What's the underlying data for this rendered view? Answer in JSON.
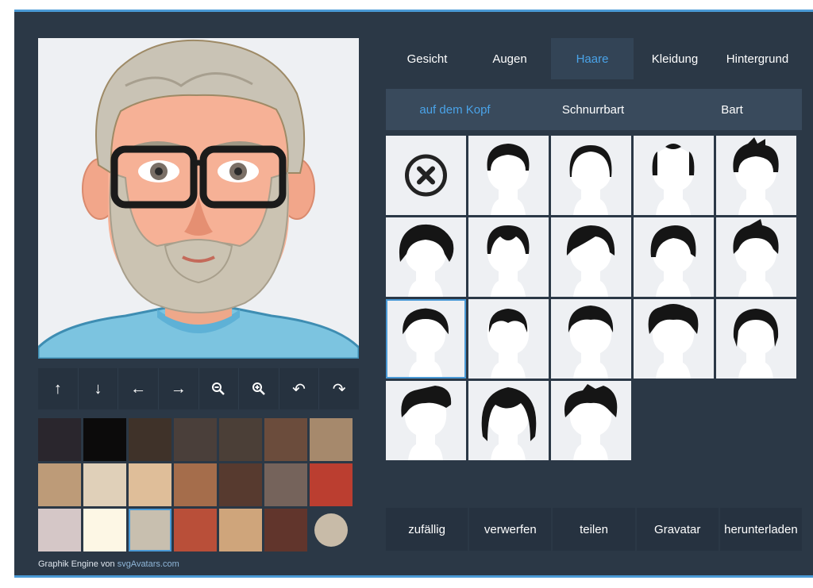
{
  "tabs": [
    {
      "label": "Gesicht",
      "active": false
    },
    {
      "label": "Augen",
      "active": false
    },
    {
      "label": "Haare",
      "active": true
    },
    {
      "label": "Kleidung",
      "active": false
    },
    {
      "label": "Hintergrund",
      "active": false
    }
  ],
  "subtabs": [
    {
      "label": "auf dem Kopf",
      "active": true
    },
    {
      "label": "Schnurrbart",
      "active": false
    },
    {
      "label": "Bart",
      "active": false
    }
  ],
  "controls": [
    {
      "name": "move-up-button",
      "icon": "arrow-up-icon",
      "glyph": "↑"
    },
    {
      "name": "move-down-button",
      "icon": "arrow-down-icon",
      "glyph": "↓"
    },
    {
      "name": "move-left-button",
      "icon": "arrow-left-icon",
      "glyph": "←"
    },
    {
      "name": "move-right-button",
      "icon": "arrow-right-icon",
      "glyph": "→"
    },
    {
      "name": "zoom-out-button",
      "icon": "zoom-out-icon",
      "glyph": ""
    },
    {
      "name": "zoom-in-button",
      "icon": "zoom-in-icon",
      "glyph": ""
    },
    {
      "name": "undo-button",
      "icon": "undo-icon",
      "glyph": "↶"
    },
    {
      "name": "redo-button",
      "icon": "redo-icon",
      "glyph": "↷"
    }
  ],
  "colors": [
    "#2a262d",
    "#0c0b0b",
    "#3f3229",
    "#4a3f3a",
    "#4b3f37",
    "#6b4c3c",
    "#a6896c",
    "#bd9b78",
    "#e0d0b9",
    "#dfbe99",
    "#a56d4b",
    "#573a2f",
    "#75635b",
    "#bb3e30",
    "#d5c7c7",
    "#fdf7e5",
    "#c8bfaf",
    "#b94f39",
    "#cfa57b",
    "#61352c",
    "#c8bba8"
  ],
  "selected_color": "#c8bfaf",
  "hair_styles": [
    "none",
    "style-1",
    "style-2",
    "style-3",
    "style-4",
    "style-5",
    "style-6",
    "style-7",
    "style-8",
    "style-9",
    "style-10",
    "style-11",
    "style-12",
    "style-13",
    "style-14",
    "style-15",
    "style-16",
    "style-17"
  ],
  "selected_hair_index": 10,
  "actions": [
    {
      "label": "zufällig",
      "name": "random-button"
    },
    {
      "label": "verwerfen",
      "name": "discard-button"
    },
    {
      "label": "teilen",
      "name": "share-button"
    },
    {
      "label": "Gravatar",
      "name": "gravatar-button"
    },
    {
      "label": "herunterladen",
      "name": "download-button"
    }
  ],
  "credit": {
    "prefix": "Graphik Engine von",
    "link": "svgAvatars.com"
  }
}
